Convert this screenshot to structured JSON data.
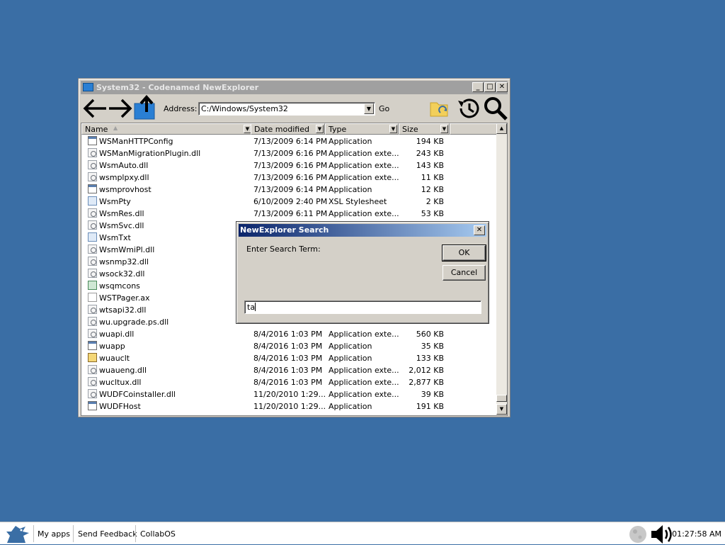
{
  "window": {
    "title": "System32 - Codenamed NewExplorer",
    "address_label": "Address:",
    "address_value": "C:/Windows/System32",
    "go_label": "Go",
    "minimize": "_",
    "maximize": "□",
    "close": "✕"
  },
  "columns": {
    "name": "Name",
    "date": "Date modified",
    "type": "Type",
    "size": "Size"
  },
  "files": [
    {
      "name": "WSManHTTPConfig",
      "date": "7/13/2009 6:14 PM",
      "type": "Application",
      "size": "194 KB",
      "icon": "app"
    },
    {
      "name": "WSManMigrationPlugin.dll",
      "date": "7/13/2009 6:16 PM",
      "type": "Application exte...",
      "size": "243 KB",
      "icon": "dll"
    },
    {
      "name": "WsmAuto.dll",
      "date": "7/13/2009 6:16 PM",
      "type": "Application exte...",
      "size": "143 KB",
      "icon": "dll"
    },
    {
      "name": "wsmplpxy.dll",
      "date": "7/13/2009 6:16 PM",
      "type": "Application exte...",
      "size": "11 KB",
      "icon": "dll"
    },
    {
      "name": "wsmprovhost",
      "date": "7/13/2009 6:14 PM",
      "type": "Application",
      "size": "12 KB",
      "icon": "app"
    },
    {
      "name": "WsmPty",
      "date": "6/10/2009 2:40 PM",
      "type": "XSL Stylesheet",
      "size": "2 KB",
      "icon": "xsl"
    },
    {
      "name": "WsmRes.dll",
      "date": "7/13/2009 6:11 PM",
      "type": "Application exte...",
      "size": "53 KB",
      "icon": "dll"
    },
    {
      "name": "WsmSvc.dll",
      "date": "",
      "type": "",
      "size": "",
      "icon": "dll"
    },
    {
      "name": "WsmTxt",
      "date": "",
      "type": "",
      "size": "",
      "icon": "xsl"
    },
    {
      "name": "WsmWmiPl.dll",
      "date": "",
      "type": "",
      "size": "",
      "icon": "dll"
    },
    {
      "name": "wsnmp32.dll",
      "date": "",
      "type": "",
      "size": "",
      "icon": "dll"
    },
    {
      "name": "wsock32.dll",
      "date": "",
      "type": "",
      "size": "",
      "icon": "dll"
    },
    {
      "name": "wsqmcons",
      "date": "",
      "type": "",
      "size": "",
      "icon": "msc"
    },
    {
      "name": "WSTPager.ax",
      "date": "",
      "type": "",
      "size": "",
      "icon": "blank"
    },
    {
      "name": "wtsapi32.dll",
      "date": "",
      "type": "",
      "size": "",
      "icon": "dll"
    },
    {
      "name": "wu.upgrade.ps.dll",
      "date": "",
      "type": "",
      "size": "",
      "icon": "dll"
    },
    {
      "name": "wuapi.dll",
      "date": "8/4/2016 1:03 PM",
      "type": "Application exte...",
      "size": "560 KB",
      "icon": "dll"
    },
    {
      "name": "wuapp",
      "date": "8/4/2016 1:03 PM",
      "type": "Application",
      "size": "35 KB",
      "icon": "app"
    },
    {
      "name": "wuauclt",
      "date": "8/4/2016 1:03 PM",
      "type": "Application",
      "size": "133 KB",
      "icon": "upd"
    },
    {
      "name": "wuaueng.dll",
      "date": "8/4/2016 1:03 PM",
      "type": "Application exte...",
      "size": "2,012 KB",
      "icon": "dll"
    },
    {
      "name": "wucltux.dll",
      "date": "8/4/2016 1:03 PM",
      "type": "Application exte...",
      "size": "2,877 KB",
      "icon": "dll"
    },
    {
      "name": "WUDFCoinstaller.dll",
      "date": "11/20/2010 1:29...",
      "type": "Application exte...",
      "size": "39 KB",
      "icon": "dll"
    },
    {
      "name": "WUDFHost",
      "date": "11/20/2010 1:29...",
      "type": "Application",
      "size": "191 KB",
      "icon": "app"
    }
  ],
  "dialog": {
    "title": "NewExplorer Search",
    "prompt": "Enter Search Term:",
    "ok": "OK",
    "cancel": "Cancel",
    "close": "✕",
    "input_value": "ta"
  },
  "taskbar": {
    "my_apps": "My apps",
    "send_feedback": "Send Feedback",
    "collabos": "CollabOS",
    "clock": "01:27:58 AM"
  },
  "colors": {
    "desktop": "#3a6ea5",
    "dialog_title": "#0a246a",
    "folder_blue": "#2a7fd4"
  }
}
